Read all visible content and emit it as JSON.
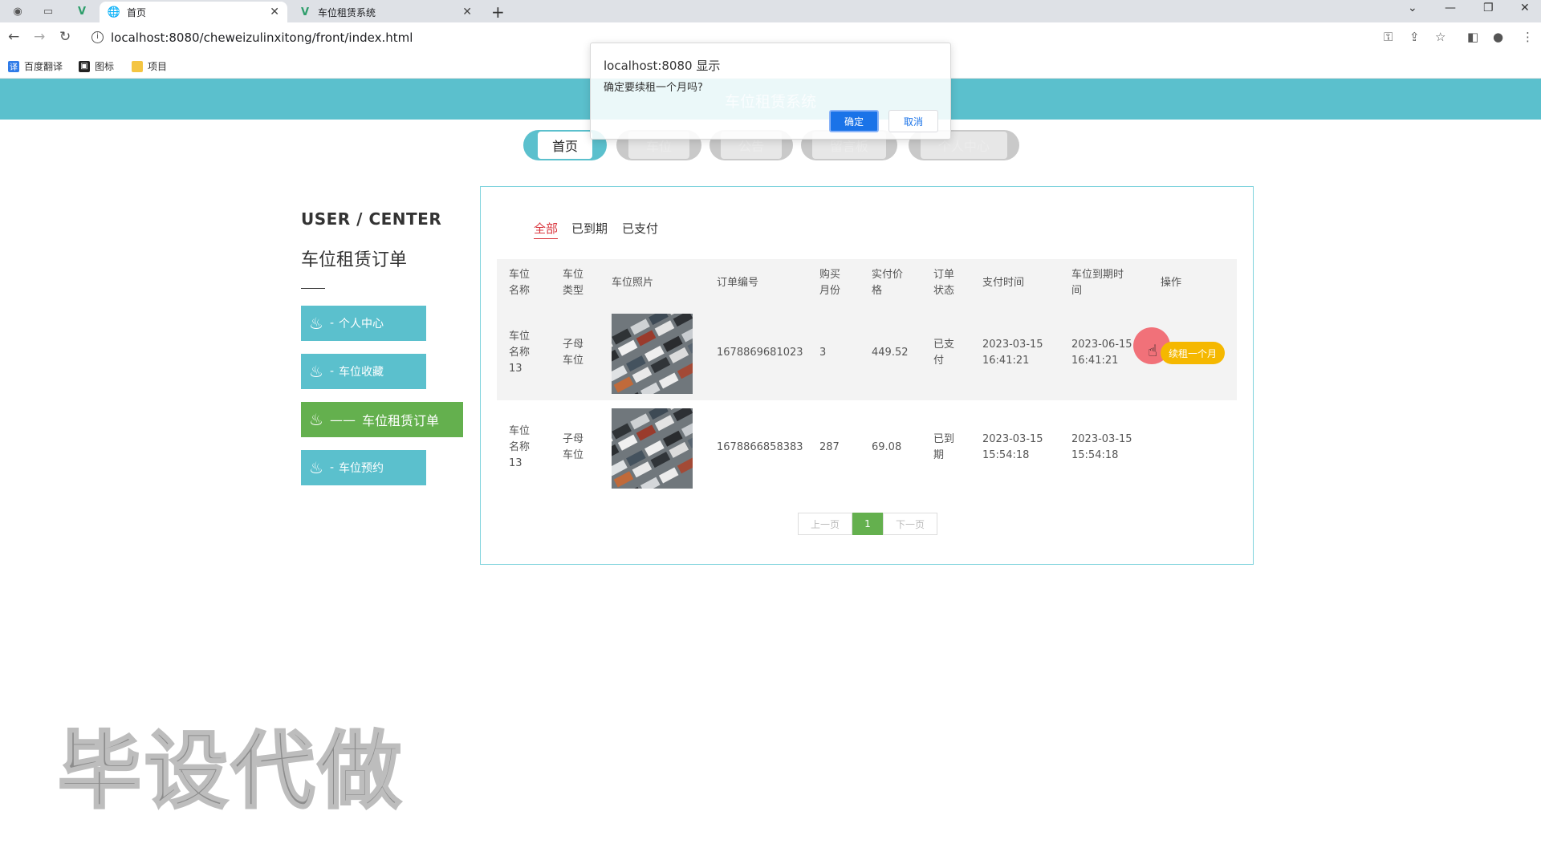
{
  "browser": {
    "tabs": [
      {
        "label": "首页",
        "icon": "globe-icon"
      },
      {
        "label": "车位租赁系统",
        "icon": "vue-logo-icon"
      }
    ],
    "url": "localhost:8080/cheweizulinxitong/front/index.html",
    "bookmarks": [
      "百度翻译",
      "图标",
      "项目"
    ]
  },
  "site": {
    "title": "车位租赁系统",
    "nav": [
      "首页",
      "车位",
      "公告",
      "留言板",
      "个人中心"
    ]
  },
  "sidebar": {
    "title": "USER / CENTER",
    "subtitle": "车位租赁订单",
    "items": [
      {
        "label": "个人中心"
      },
      {
        "label": "车位收藏"
      },
      {
        "label": "车位租赁订单",
        "active_prefix": "——"
      },
      {
        "label": "车位预约"
      }
    ]
  },
  "filters": [
    "全部",
    "已到期",
    "已支付"
  ],
  "table": {
    "headers": [
      "车位\n名称",
      "车位\n类型",
      "车位照片",
      "订单编号",
      "购买\n月份",
      "实付价\n格",
      "订单\n状态",
      "支付时间",
      "车位到期时\n间",
      "操作"
    ],
    "rows": [
      {
        "name": "车位\n名称\n13",
        "type": "子母\n车位",
        "order_no": "1678869681023",
        "months": "3",
        "price": "449.52",
        "status": "已支\n付",
        "pay_time": "2023-03-15\n16:41:21",
        "expire_time": "2023-06-15\n16:41:21",
        "action": "续租一个月"
      },
      {
        "name": "车位\n名称\n13",
        "type": "子母\n车位",
        "order_no": "1678866858383",
        "months": "287",
        "price": "69.08",
        "status": "已到\n期",
        "pay_time": "2023-03-15\n15:54:18",
        "expire_time": "2023-03-15\n15:54:18",
        "action": ""
      }
    ]
  },
  "pagination": {
    "prev": "上一页",
    "current": "1",
    "next": "下一页"
  },
  "watermark": "毕设代做",
  "dialog": {
    "host": "localhost:8080 显示",
    "message": "确定要续租一个月吗?",
    "ok": "确定",
    "cancel": "取消"
  },
  "colors": {
    "primary": "#5bc0cd",
    "active": "#64b04e",
    "renew": "#f5b800",
    "filter_active": "#d9363e"
  }
}
